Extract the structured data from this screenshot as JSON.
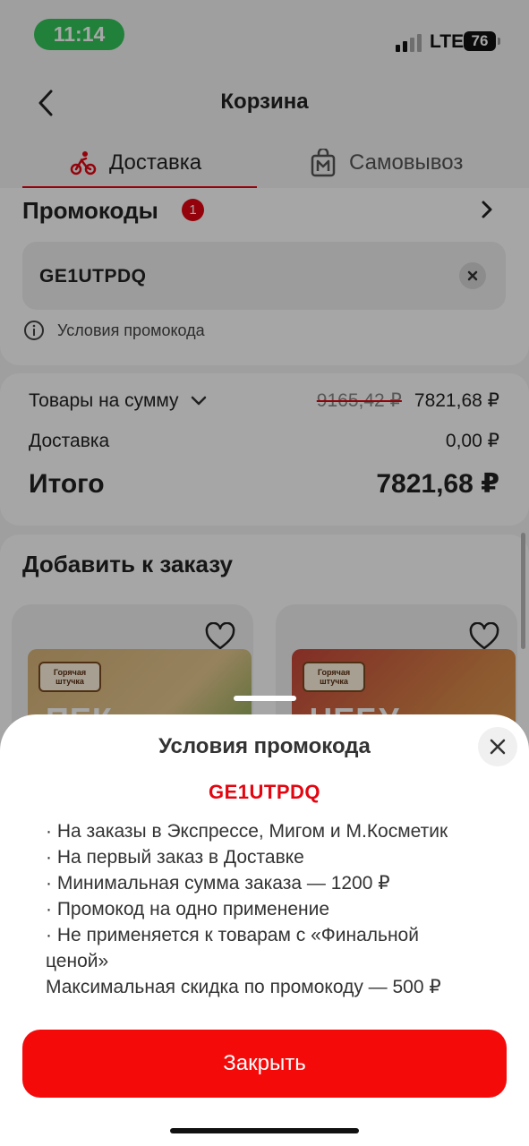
{
  "status_bar": {
    "time": "11:14",
    "network": "LTE",
    "battery": "76"
  },
  "header": {
    "title": "Корзина"
  },
  "tabs": [
    {
      "label": "Доставка",
      "icon": "bike-icon",
      "active": true
    },
    {
      "label": "Самовывоз",
      "icon": "shop-bag-icon",
      "active": false
    }
  ],
  "promo": {
    "title": "Промокоды",
    "badge": "1",
    "code": "GE1UTPDQ",
    "conditions_link": "Условия промокода"
  },
  "summary": {
    "goods_label": "Товары на сумму",
    "goods_old_price": "9165,42 ₽",
    "goods_price": "7821,68 ₽",
    "delivery_label": "Доставка",
    "delivery_price": "0,00 ₽",
    "total_label": "Итого",
    "total_price": "7821,68 ₽"
  },
  "add_to_order": {
    "title": "Добавить к заказу",
    "products": [
      {
        "brand": "Горячая штучка",
        "name_part": "ПЕК"
      },
      {
        "brand": "Горячая штучка",
        "name_part": "ЧЕБУ"
      }
    ]
  },
  "sheet": {
    "title": "Условия промокода",
    "code": "GE1UTPDQ",
    "lines": [
      "· На заказы в Экспрессе, Мигом и М.Косметик",
      "· На первый заказ в Доставке",
      "· Минимальная сумма заказа — 1200 ₽",
      "· Промокод на одно применение",
      "· Не применяется к товарам с «Финальной",
      "ценой»",
      "Максимальная скидка по промокоду — 500 ₽"
    ],
    "close_button": "Закрыть"
  },
  "colors": {
    "accent": "#e30611",
    "button": "#f50a0a",
    "time_pill": "#34c759"
  }
}
